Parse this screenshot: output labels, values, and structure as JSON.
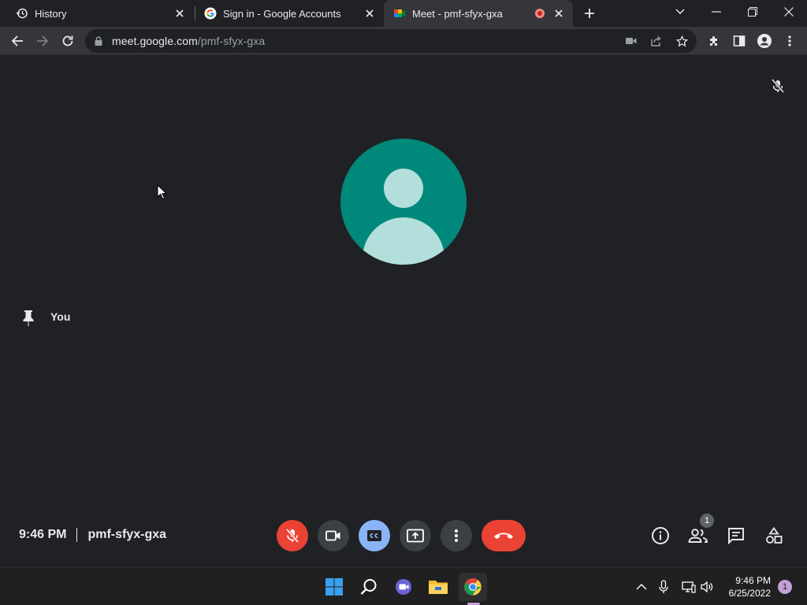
{
  "browser": {
    "tabs": [
      {
        "title": "History",
        "icon": "history-icon",
        "active": false
      },
      {
        "title": "Sign in - Google Accounts",
        "icon": "google-icon",
        "active": false
      },
      {
        "title": "Meet - pmf-sfyx-gxa",
        "icon": "meet-icon",
        "active": true,
        "recording": true
      }
    ],
    "url_host": "meet.google.com",
    "url_path": "/pmf-sfyx-gxa"
  },
  "meet": {
    "participant_name": "You",
    "time": "9:46 PM",
    "meeting_code": "pmf-sfyx-gxa",
    "participant_count": "1",
    "colors": {
      "avatar_bg": "#00897b",
      "avatar_fg": "#b2dfdb",
      "mic_off": "#ea4335",
      "captions_on": "#8ab4f8",
      "end_call": "#ea4335"
    }
  },
  "taskbar": {
    "time": "9:46 PM",
    "date": "6/25/2022",
    "notification_count": "1"
  }
}
